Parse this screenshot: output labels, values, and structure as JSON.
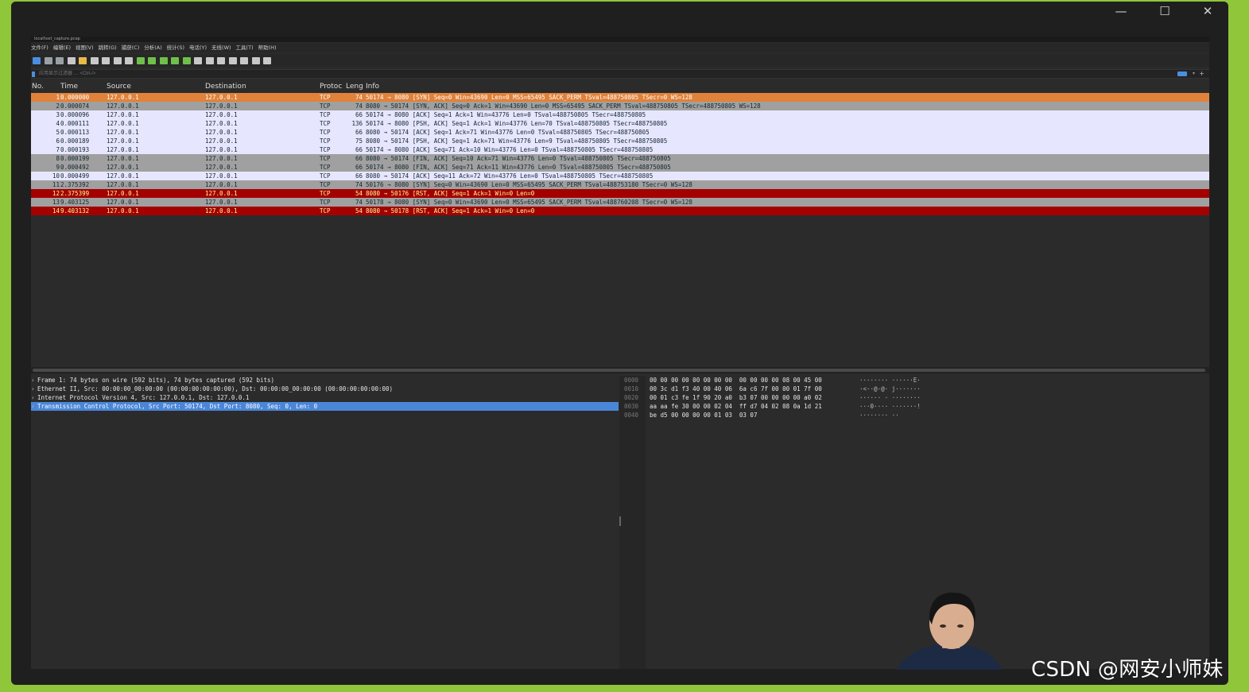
{
  "window": {
    "minimize_glyph": "—",
    "maximize_glyph": "☐",
    "close_glyph": "✕"
  },
  "app": {
    "title": "localhost_capture.pcap",
    "menus": [
      "文件(F)",
      "编辑(E)",
      "视图(V)",
      "跳转(G)",
      "捕获(C)",
      "分析(A)",
      "统计(S)",
      "电话(Y)",
      "无线(W)",
      "工具(T)",
      "帮助(H)"
    ],
    "toolbar_icons": [
      {
        "name": "shark-fin-start-icon",
        "color": "#4a8fe0"
      },
      {
        "name": "stop-icon",
        "color": "#9aa0a6"
      },
      {
        "name": "restart-icon",
        "color": "#9aa0a6"
      },
      {
        "name": "options-gear-icon",
        "color": "#c8c8c8"
      },
      {
        "name": "open-file-icon",
        "color": "#e9b949"
      },
      {
        "name": "save-file-icon",
        "color": "#c8c8c8"
      },
      {
        "name": "close-file-icon",
        "color": "#c8c8c8"
      },
      {
        "name": "reload-icon",
        "color": "#c8c8c8"
      },
      {
        "name": "find-packet-icon",
        "color": "#c8c8c8"
      },
      {
        "name": "go-back-icon",
        "color": "#6fbf4a"
      },
      {
        "name": "go-forward-icon",
        "color": "#6fbf4a"
      },
      {
        "name": "go-to-packet-icon",
        "color": "#6fbf4a"
      },
      {
        "name": "go-first-icon",
        "color": "#6fbf4a"
      },
      {
        "name": "go-last-icon",
        "color": "#6fbf4a"
      },
      {
        "name": "auto-scroll-icon",
        "color": "#c8c8c8"
      },
      {
        "name": "colorize-icon",
        "color": "#c8c8c8"
      },
      {
        "name": "zoom-in-icon",
        "color": "#c8c8c8"
      },
      {
        "name": "zoom-out-icon",
        "color": "#c8c8c8"
      },
      {
        "name": "zoom-reset-icon",
        "color": "#c8c8c8"
      },
      {
        "name": "resize-columns-icon",
        "color": "#c8c8c8"
      },
      {
        "name": "layout-icon",
        "color": "#c8c8c8"
      }
    ],
    "filter": {
      "placeholder": "应用显示过滤器 … <Ctrl-/>",
      "value": ""
    }
  },
  "packet_list": {
    "columns": [
      "No.",
      "Time",
      "Source",
      "Destination",
      "Protocol",
      "Length",
      "Info"
    ],
    "column_headers_display": [
      "No.",
      "Time",
      "Source",
      "Destination",
      "Protoc",
      "Leng",
      "Info"
    ],
    "rows": [
      {
        "no": "1",
        "time": "0.000000",
        "src": "127.0.0.1",
        "dst": "127.0.0.1",
        "proto": "TCP",
        "len": "74",
        "info": "50174 → 8080 [SYN] Seq=0 Win=43690 Len=0 MSS=65495 SACK_PERM TSval=488750805 TSecr=0 WS=128",
        "bg": "#e0823a",
        "fg": "#ffffff"
      },
      {
        "no": "2",
        "time": "0.000074",
        "src": "127.0.0.1",
        "dst": "127.0.0.1",
        "proto": "TCP",
        "len": "74",
        "info": "8080 → 50174 [SYN, ACK] Seq=0 Ack=1 Win=43690 Len=0 MSS=65495 SACK_PERM TSval=488750805 TSecr=488750805 WS=128",
        "bg": "#a0a0a0",
        "fg": "#12272e"
      },
      {
        "no": "3",
        "time": "0.000096",
        "src": "127.0.0.1",
        "dst": "127.0.0.1",
        "proto": "TCP",
        "len": "66",
        "info": "50174 → 8080 [ACK] Seq=1 Ack=1 Win=43776 Len=0 TSval=488750805 TSecr=488750805",
        "bg": "#e7e6ff",
        "fg": "#12272e"
      },
      {
        "no": "4",
        "time": "0.000111",
        "src": "127.0.0.1",
        "dst": "127.0.0.1",
        "proto": "TCP",
        "len": "136",
        "info": "50174 → 8080 [PSH, ACK] Seq=1 Ack=1 Win=43776 Len=70 TSval=488750805 TSecr=488750805",
        "bg": "#e7e6ff",
        "fg": "#12272e"
      },
      {
        "no": "5",
        "time": "0.000113",
        "src": "127.0.0.1",
        "dst": "127.0.0.1",
        "proto": "TCP",
        "len": "66",
        "info": "8080 → 50174 [ACK] Seq=1 Ack=71 Win=43776 Len=0 TSval=488750805 TSecr=488750805",
        "bg": "#e7e6ff",
        "fg": "#12272e"
      },
      {
        "no": "6",
        "time": "0.000189",
        "src": "127.0.0.1",
        "dst": "127.0.0.1",
        "proto": "TCP",
        "len": "75",
        "info": "8080 → 50174 [PSH, ACK] Seq=1 Ack=71 Win=43776 Len=9 TSval=488750805 TSecr=488750805",
        "bg": "#e7e6ff",
        "fg": "#12272e"
      },
      {
        "no": "7",
        "time": "0.000193",
        "src": "127.0.0.1",
        "dst": "127.0.0.1",
        "proto": "TCP",
        "len": "66",
        "info": "50174 → 8080 [ACK] Seq=71 Ack=10 Win=43776 Len=0 TSval=488750805 TSecr=488750805",
        "bg": "#e7e6ff",
        "fg": "#12272e"
      },
      {
        "no": "8",
        "time": "0.000199",
        "src": "127.0.0.1",
        "dst": "127.0.0.1",
        "proto": "TCP",
        "len": "66",
        "info": "8080 → 50174 [FIN, ACK] Seq=10 Ack=71 Win=43776 Len=0 TSval=488750805 TSecr=488750805",
        "bg": "#a0a0a0",
        "fg": "#12272e"
      },
      {
        "no": "9",
        "time": "0.000492",
        "src": "127.0.0.1",
        "dst": "127.0.0.1",
        "proto": "TCP",
        "len": "66",
        "info": "50174 → 8080 [FIN, ACK] Seq=71 Ack=11 Win=43776 Len=0 TSval=488750805 TSecr=488750805",
        "bg": "#a0a0a0",
        "fg": "#12272e"
      },
      {
        "no": "10",
        "time": "0.000499",
        "src": "127.0.0.1",
        "dst": "127.0.0.1",
        "proto": "TCP",
        "len": "66",
        "info": "8080 → 50174 [ACK] Seq=11 Ack=72 Win=43776 Len=0 TSval=488750805 TSecr=488750805",
        "bg": "#e7e6ff",
        "fg": "#12272e"
      },
      {
        "no": "11",
        "time": "2.375392",
        "src": "127.0.0.1",
        "dst": "127.0.0.1",
        "proto": "TCP",
        "len": "74",
        "info": "50176 → 8080 [SYN] Seq=0 Win=43690 Len=0 MSS=65495 SACK_PERM TSval=488753180 TSecr=0 WS=128",
        "bg": "#a0a0a0",
        "fg": "#12272e"
      },
      {
        "no": "12",
        "time": "2.375399",
        "src": "127.0.0.1",
        "dst": "127.0.0.1",
        "proto": "TCP",
        "len": "54",
        "info": "8080 → 50176 [RST, ACK] Seq=1 Ack=1 Win=0 Len=0",
        "bg": "#a40000",
        "fg": "#fffc9c"
      },
      {
        "no": "13",
        "time": "9.403125",
        "src": "127.0.0.1",
        "dst": "127.0.0.1",
        "proto": "TCP",
        "len": "74",
        "info": "50178 → 8080 [SYN] Seq=0 Win=43690 Len=0 MSS=65495 SACK_PERM TSval=488760208 TSecr=0 WS=128",
        "bg": "#a0a0a0",
        "fg": "#12272e"
      },
      {
        "no": "14",
        "time": "9.403132",
        "src": "127.0.0.1",
        "dst": "127.0.0.1",
        "proto": "TCP",
        "len": "54",
        "info": "8080 → 50178 [RST, ACK] Seq=1 Ack=1 Win=0 Len=0",
        "bg": "#a40000",
        "fg": "#fffc9c"
      }
    ]
  },
  "packet_details": [
    {
      "text": "Frame 1: 74 bytes on wire (592 bits), 74 bytes captured (592 bits)",
      "selected": false
    },
    {
      "text": "Ethernet II, Src: 00:00:00_00:00:00 (00:00:00:00:00:00), Dst: 00:00:00_00:00:00 (00:00:00:00:00:00)",
      "selected": false
    },
    {
      "text": "Internet Protocol Version 4, Src: 127.0.0.1, Dst: 127.0.0.1",
      "selected": false
    },
    {
      "text": "Transmission Control Protocol, Src Port: 50174, Dst Port: 8080, Seq: 0, Len: 0",
      "selected": true
    }
  ],
  "packet_bytes": [
    {
      "offset": "0000",
      "hex": "00 00 00 00 00 00 00 00  00 00 00 00 08 00 45 00",
      "ascii": "········ ······E·"
    },
    {
      "offset": "0010",
      "hex": "00 3c d1 f3 40 00 40 06  6a c6 7f 00 00 01 7f 00",
      "ascii": "·<··@·@· j·······"
    },
    {
      "offset": "0020",
      "hex": "00 01 c3 fe 1f 90 20 a0  b3 07 00 00 00 00 a0 02",
      "ascii": "······ · ········"
    },
    {
      "offset": "0030",
      "hex": "aa aa fe 30 00 00 02 04  ff d7 04 02 08 0a 1d 21",
      "ascii": "···0···· ·······!"
    },
    {
      "offset": "0040",
      "hex": "be d5 00 00 00 00 01 03  03 07",
      "ascii": "········ ··"
    }
  ],
  "watermark": "CSDN @网安小师妹"
}
